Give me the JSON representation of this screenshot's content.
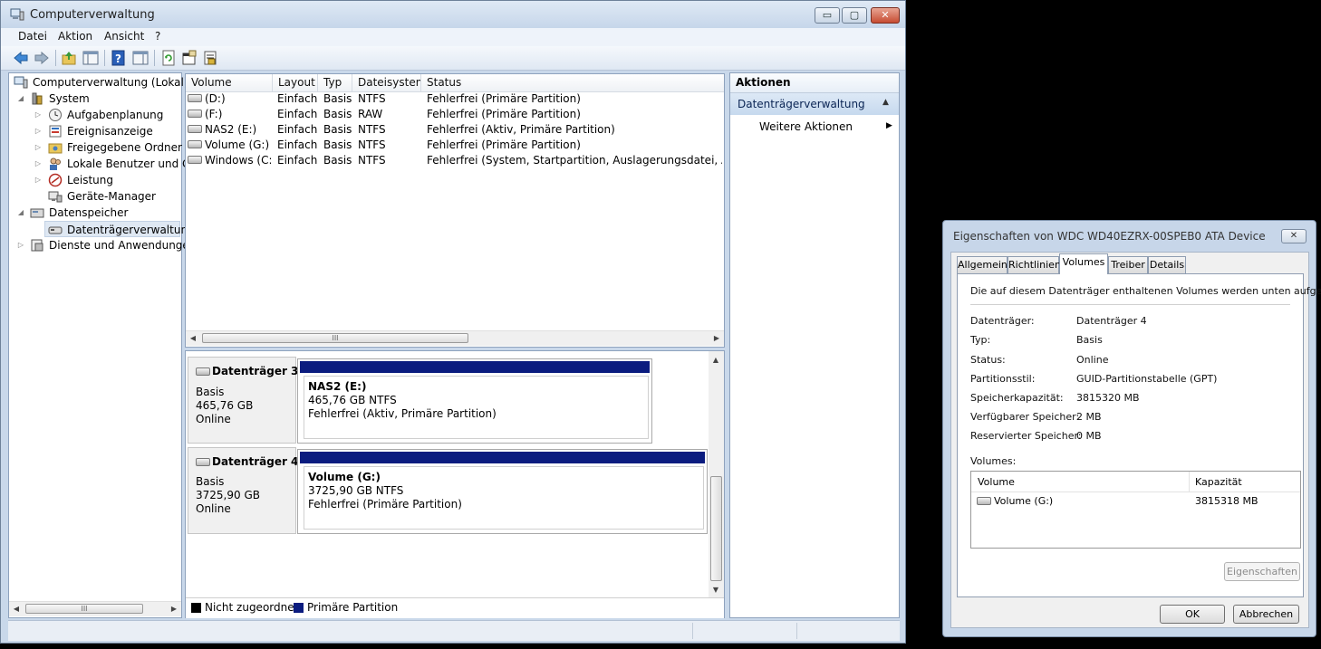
{
  "window": {
    "title": "Computerverwaltung",
    "minimize_glyph": "▭",
    "maximize_glyph": "▢",
    "close_glyph": "✕"
  },
  "menu": {
    "items": [
      "Datei",
      "Aktion",
      "Ansicht",
      "?"
    ]
  },
  "toolbar": {
    "icons": [
      "back-arrow-icon",
      "forward-arrow-icon",
      "up-folder-icon",
      "show-hide-tree-icon",
      "help-icon",
      "show-hide-action-pane-icon",
      "refresh-icon",
      "properties-icon",
      "export-list-icon"
    ]
  },
  "tree": {
    "root": "Computerverwaltung (Lokal)",
    "system": "System",
    "aufgabenplanung": "Aufgabenplanung",
    "ereignisanzeige": "Ereignisanzeige",
    "freigegebene": "Freigegebene Ordner",
    "lokale_benutzer": "Lokale Benutzer und Gru",
    "leistung": "Leistung",
    "geraete_manager": "Geräte-Manager",
    "datenspeicher": "Datenspeicher",
    "datentraegerverwaltung": "Datenträgerverwaltung",
    "dienste": "Dienste und Anwendungen",
    "scroll_thumb_glyph": "III"
  },
  "volumes": {
    "columns": [
      "Volume",
      "Layout",
      "Typ",
      "Dateisystem",
      "Status"
    ],
    "rows": [
      [
        "(D:)",
        "Einfach",
        "Basis",
        "NTFS",
        "Fehlerfrei (Primäre Partition)"
      ],
      [
        "(F:)",
        "Einfach",
        "Basis",
        "RAW",
        "Fehlerfrei (Primäre Partition)"
      ],
      [
        "NAS2 (E:)",
        "Einfach",
        "Basis",
        "NTFS",
        "Fehlerfrei (Aktiv, Primäre Partition)"
      ],
      [
        "Volume (G:)",
        "Einfach",
        "Basis",
        "NTFS",
        "Fehlerfrei (Primäre Partition)"
      ],
      [
        "Windows (C:)",
        "Einfach",
        "Basis",
        "NTFS",
        "Fehlerfrei (System, Startpartition, Auslagerungsdatei, Aktiv, Ab"
      ]
    ],
    "scroll_thumb_glyph": "III"
  },
  "disks": [
    {
      "title": "Datenträger 3",
      "type": "Basis",
      "size": "465,76 GB",
      "state": "Online",
      "partition": {
        "name": "NAS2  (E:)",
        "size_fs": "465,76 GB NTFS",
        "status": "Fehlerfrei (Aktiv, Primäre Partition)"
      }
    },
    {
      "title": "Datenträger 4",
      "type": "Basis",
      "size": "3725,90 GB",
      "state": "Online",
      "partition": {
        "name": "Volume  (G:)",
        "size_fs": "3725,90 GB NTFS",
        "status": "Fehlerfrei (Primäre Partition)"
      }
    }
  ],
  "legend": {
    "unallocated": "Nicht zugeordnet",
    "primary": "Primäre Partition",
    "unallocated_color": "#000000",
    "primary_color": "#0b1c7f"
  },
  "actions": {
    "title": "Aktionen",
    "section": "Datenträgerverwaltung",
    "more": "Weitere Aktionen"
  },
  "dialog": {
    "title": "Eigenschaften von WDC WD40EZRX-00SPEB0 ATA Device",
    "tabs": [
      "Allgemein",
      "Richtlinien",
      "Volumes",
      "Treiber",
      "Details"
    ],
    "active_tab": "Volumes",
    "intro": "Die auf diesem Datenträger enthaltenen Volumes werden unten aufgeführt.",
    "props": [
      {
        "label": "Datenträger:",
        "value": "Datenträger 4"
      },
      {
        "label": "Typ:",
        "value": "Basis"
      },
      {
        "label": "Status:",
        "value": "Online"
      },
      {
        "label": "Partitionsstil:",
        "value": "GUID-Partitionstabelle (GPT)"
      },
      {
        "label": "Speicherkapazität:",
        "value": "3815320 MB"
      },
      {
        "label": "Verfügbarer Speicher:",
        "value": "2 MB"
      },
      {
        "label": "Reservierter Speicher:",
        "value": "0 MB"
      }
    ],
    "volumes_label": "Volumes:",
    "vol_columns": [
      "Volume",
      "Kapazität"
    ],
    "vol_rows": [
      [
        "Volume (G:)",
        "3815318 MB"
      ]
    ],
    "properties_button": "Eigenschaften",
    "ok_button": "OK",
    "cancel_button": "Abbrechen"
  }
}
